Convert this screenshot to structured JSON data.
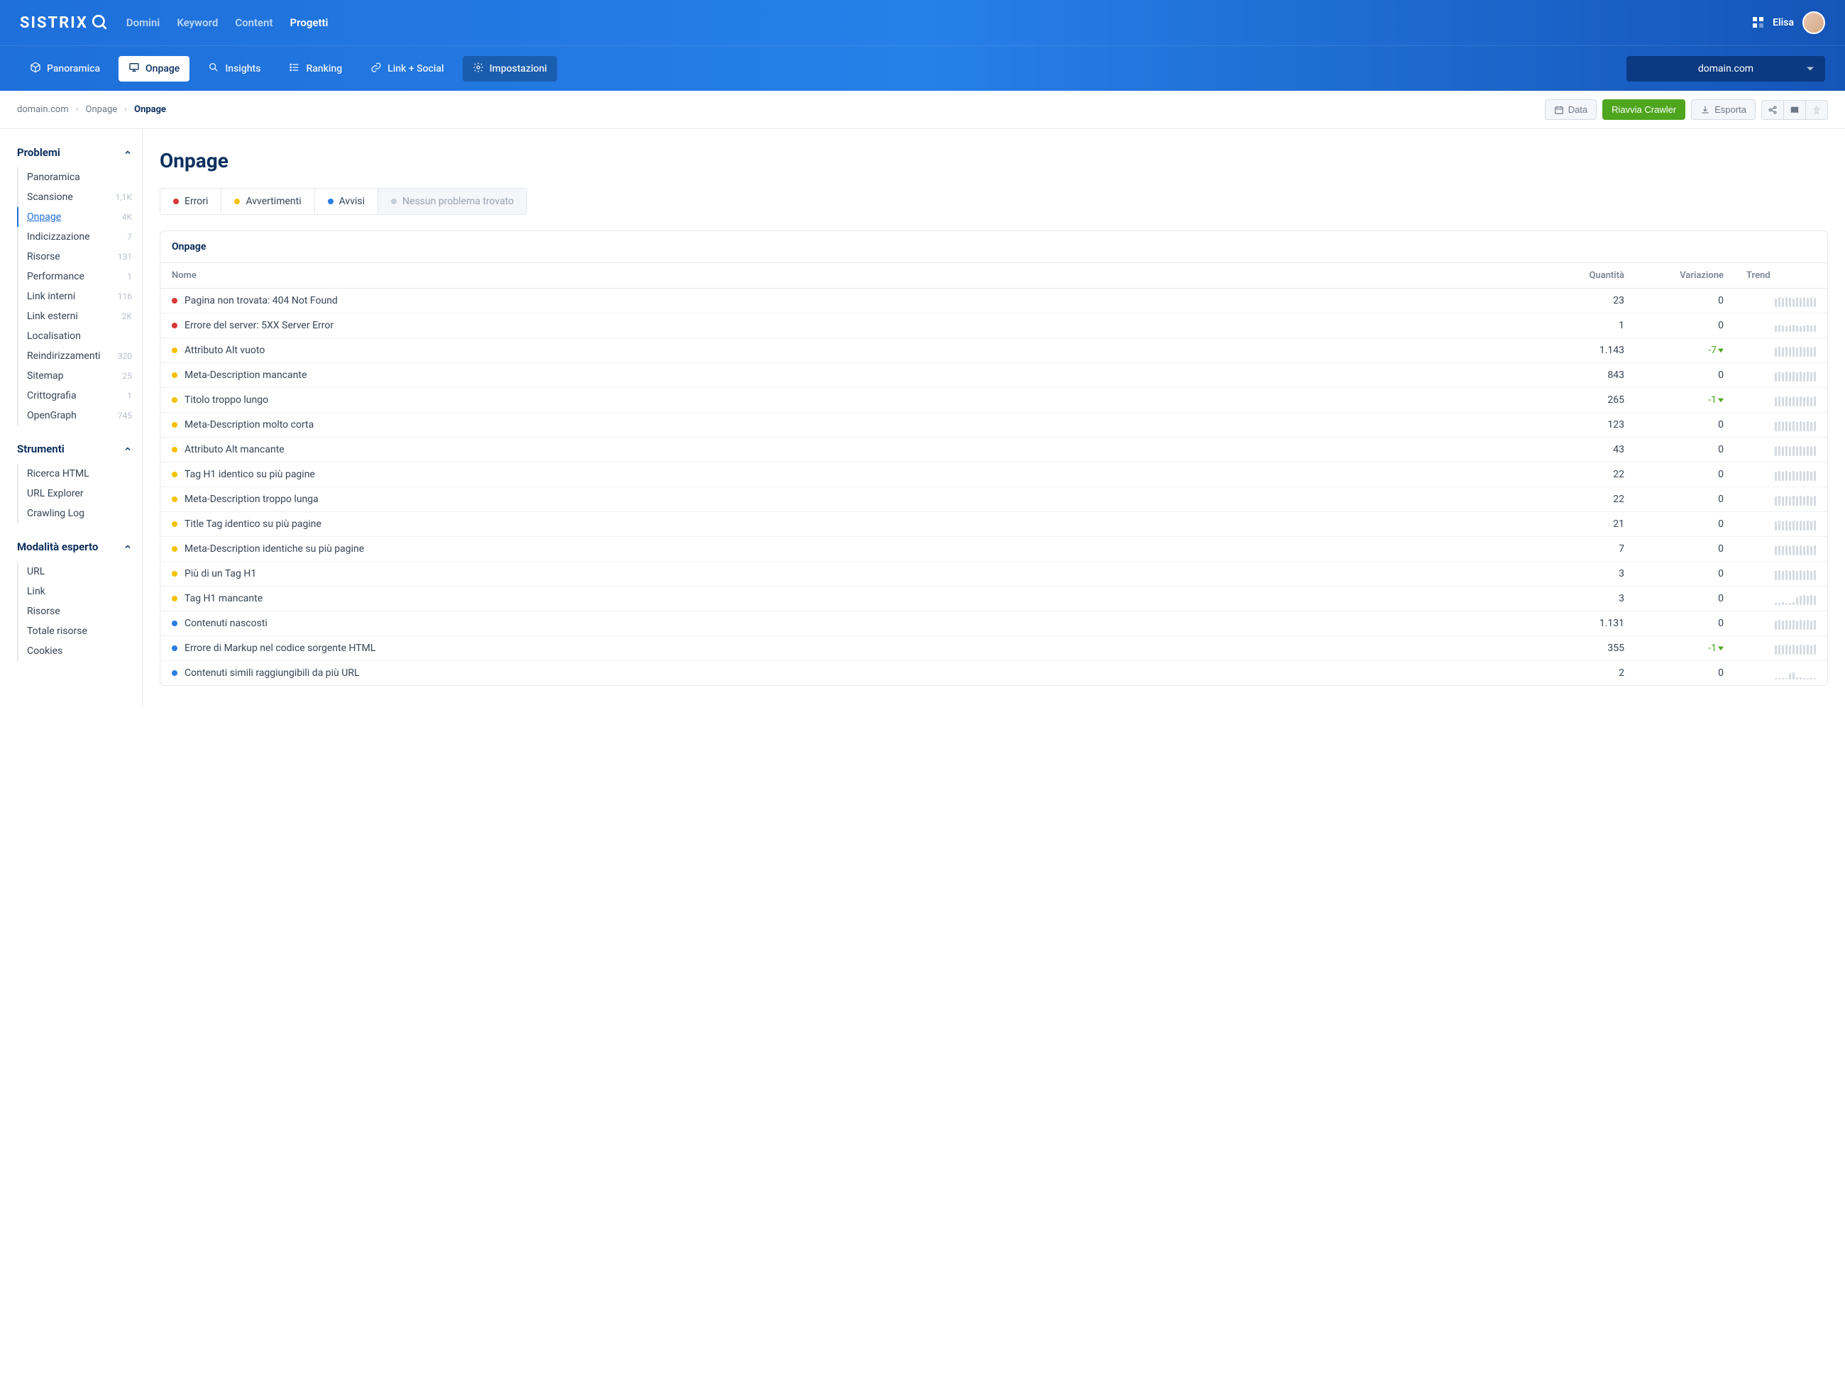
{
  "logo": "SISTRIX",
  "topnav": [
    "Domini",
    "Keyword",
    "Content",
    "Progetti"
  ],
  "topnav_active": 3,
  "user": "Elisa",
  "subnav": [
    {
      "icon": "cube",
      "label": "Panoramica"
    },
    {
      "icon": "screen",
      "label": "Onpage"
    },
    {
      "icon": "search",
      "label": "Insights"
    },
    {
      "icon": "list",
      "label": "Ranking"
    },
    {
      "icon": "link",
      "label": "Link + Social"
    },
    {
      "icon": "gear",
      "label": "Impostazioni"
    }
  ],
  "subnav_active": 1,
  "subnav_dark": 5,
  "domain": "domain.com",
  "breadcrumb": [
    "domain.com",
    "Onpage",
    "Onpage"
  ],
  "toolbar": {
    "data": "Data",
    "restart": "Riavvia Crawler",
    "export": "Esporta"
  },
  "sidebar": {
    "sections": [
      {
        "title": "Problemi",
        "items": [
          {
            "label": "Panoramica",
            "count": ""
          },
          {
            "label": "Scansione",
            "count": "1,1K"
          },
          {
            "label": "Onpage",
            "count": "4K",
            "active": true
          },
          {
            "label": "Indicizzazione",
            "count": "7"
          },
          {
            "label": "Risorse",
            "count": "131"
          },
          {
            "label": "Performance",
            "count": "1"
          },
          {
            "label": "Link interni",
            "count": "116"
          },
          {
            "label": "Link esterni",
            "count": "2K"
          },
          {
            "label": "Localisation",
            "count": ""
          },
          {
            "label": "Reindirizzamenti",
            "count": "320"
          },
          {
            "label": "Sitemap",
            "count": "25"
          },
          {
            "label": "Crittografia",
            "count": "1"
          },
          {
            "label": "OpenGraph",
            "count": "745"
          }
        ]
      },
      {
        "title": "Strumenti",
        "items": [
          {
            "label": "Ricerca HTML",
            "count": ""
          },
          {
            "label": "URL Explorer",
            "count": ""
          },
          {
            "label": "Crawling Log",
            "count": ""
          }
        ]
      },
      {
        "title": "Modalità esperto",
        "items": [
          {
            "label": "URL",
            "count": ""
          },
          {
            "label": "Link",
            "count": ""
          },
          {
            "label": "Risorse",
            "count": ""
          },
          {
            "label": "Totale risorse",
            "count": ""
          },
          {
            "label": "Cookies",
            "count": ""
          }
        ]
      }
    ]
  },
  "page_title": "Onpage",
  "tabs": [
    {
      "dot": "red",
      "label": "Errori"
    },
    {
      "dot": "yellow",
      "label": "Avvertimenti"
    },
    {
      "dot": "blue",
      "label": "Avvisi"
    },
    {
      "dot": "grey",
      "label": "Nessun problema trovato"
    }
  ],
  "panel_title": "Onpage",
  "columns": {
    "name": "Nome",
    "qty": "Quantità",
    "var": "Variazione",
    "trend": "Trend"
  },
  "rows": [
    {
      "dot": "red",
      "name": "Pagina non trovata: 404 Not Found",
      "qty": "23",
      "var": "0",
      "trend": [
        12,
        14,
        13,
        14,
        13,
        12,
        14,
        13,
        14,
        13,
        14,
        13
      ]
    },
    {
      "dot": "red",
      "name": "Errore del server: 5XX Server Error",
      "qty": "1",
      "var": "0",
      "trend": [
        9,
        10,
        9,
        8,
        9,
        10,
        9,
        8,
        9,
        10,
        9,
        10
      ]
    },
    {
      "dot": "yellow",
      "name": "Attributo Alt vuoto",
      "qty": "1.143",
      "var": "-7",
      "trend": [
        13,
        14,
        13,
        14,
        13,
        14,
        13,
        14,
        13,
        14,
        13,
        14
      ]
    },
    {
      "dot": "yellow",
      "name": "Meta-Description mancante",
      "qty": "843",
      "var": "0",
      "trend": [
        13,
        14,
        13,
        14,
        13,
        14,
        13,
        14,
        13,
        14,
        13,
        14
      ]
    },
    {
      "dot": "yellow",
      "name": "Titolo troppo lungo",
      "qty": "265",
      "var": "-1",
      "trend": [
        13,
        14,
        13,
        14,
        13,
        14,
        13,
        14,
        13,
        14,
        13,
        14
      ]
    },
    {
      "dot": "yellow",
      "name": "Meta-Description molto corta",
      "qty": "123",
      "var": "0",
      "trend": [
        13,
        14,
        13,
        14,
        13,
        14,
        13,
        14,
        13,
        14,
        13,
        14
      ]
    },
    {
      "dot": "yellow",
      "name": "Attributo Alt mancante",
      "qty": "43",
      "var": "0",
      "trend": [
        13,
        14,
        13,
        14,
        13,
        14,
        13,
        14,
        13,
        14,
        13,
        14
      ]
    },
    {
      "dot": "yellow",
      "name": "Tag H1 identico su più pagine",
      "qty": "22",
      "var": "0",
      "trend": [
        13,
        14,
        13,
        14,
        13,
        14,
        13,
        14,
        13,
        14,
        13,
        14
      ]
    },
    {
      "dot": "yellow",
      "name": "Meta-Description troppo lunga",
      "qty": "22",
      "var": "0",
      "trend": [
        13,
        14,
        13,
        14,
        13,
        14,
        13,
        14,
        13,
        14,
        13,
        14
      ]
    },
    {
      "dot": "yellow",
      "name": "Title Tag identico su più pagine",
      "qty": "21",
      "var": "0",
      "trend": [
        13,
        14,
        13,
        14,
        13,
        14,
        13,
        14,
        13,
        14,
        13,
        14
      ]
    },
    {
      "dot": "yellow",
      "name": "Meta-Description identiche su più pagine",
      "qty": "7",
      "var": "0",
      "trend": [
        13,
        14,
        13,
        14,
        13,
        14,
        13,
        14,
        13,
        14,
        13,
        14
      ]
    },
    {
      "dot": "yellow",
      "name": "Più di un Tag H1",
      "qty": "3",
      "var": "0",
      "trend": [
        13,
        14,
        13,
        14,
        13,
        14,
        13,
        14,
        13,
        14,
        13,
        14
      ]
    },
    {
      "dot": "yellow",
      "name": "Tag H1 mancante",
      "qty": "3",
      "var": "0",
      "trend": [
        3,
        3,
        4,
        3,
        3,
        4,
        11,
        13,
        14,
        13,
        14,
        13
      ]
    },
    {
      "dot": "blue",
      "name": "Contenuti nascosti",
      "qty": "1.131",
      "var": "0",
      "trend": [
        13,
        14,
        13,
        14,
        13,
        14,
        13,
        14,
        13,
        14,
        13,
        14
      ]
    },
    {
      "dot": "blue",
      "name": "Errore di Markup nel codice sorgente HTML",
      "qty": "355",
      "var": "-1",
      "trend": [
        13,
        14,
        13,
        14,
        13,
        14,
        13,
        14,
        13,
        14,
        13,
        14
      ]
    },
    {
      "dot": "blue",
      "name": "Contenuti simili raggiungibili da più URL",
      "qty": "2",
      "var": "0",
      "trend": [
        0,
        0,
        0,
        0,
        9,
        10,
        3,
        3,
        0,
        0,
        0,
        0
      ]
    }
  ]
}
